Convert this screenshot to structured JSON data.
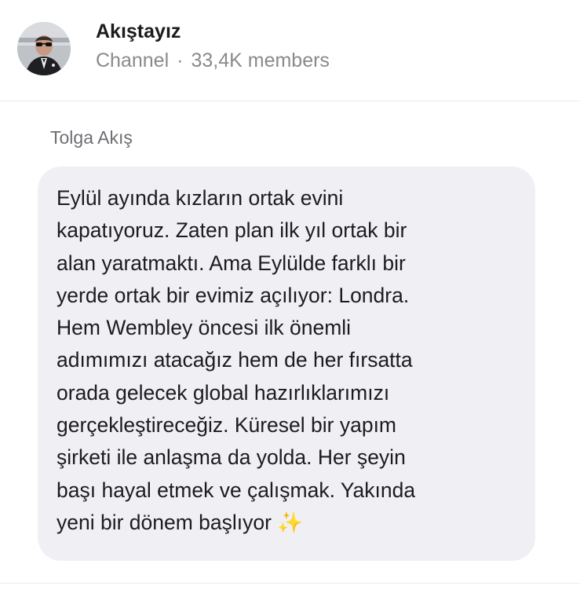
{
  "channel": {
    "name": "Akıştayız",
    "type": "Channel",
    "separator": "·",
    "members": "33,4K members"
  },
  "message": {
    "sender": "Tolga Akış",
    "text": "Eylül ayında kızların ortak evini\nkapatıyoruz. Zaten plan ilk yıl ortak bir\nalan yaratmaktı. Ama Eylülde farklı bir\nyerde ortak bir evimiz açılıyor: Londra.\nHem Wembley öncesi ilk önemli\nadımımızı atacağız hem de her fırsatta\norada gelecek global hazırlıklarımızı\ngerçekleştireceğiz. Küresel bir yapım\nşirketi ile anlaşma da yolda. Her şeyin\nbaşı hayal etmek ve çalışmak. Yakında\nyeni bir dönem başlıyor ",
    "emoji": "✨"
  },
  "colors": {
    "bubble": "#f0f0f4",
    "name_text": "#1c1c1e",
    "meta_text": "#8a8a8e"
  },
  "icons": {
    "avatar": "channel-avatar-photo"
  }
}
